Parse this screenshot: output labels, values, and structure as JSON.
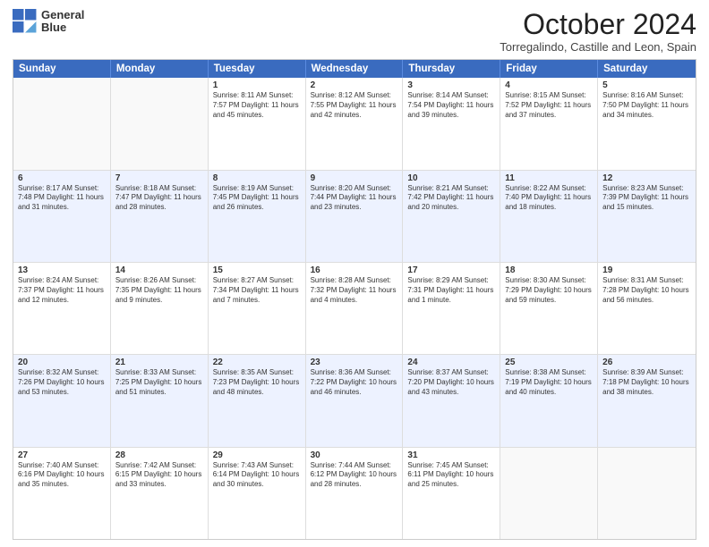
{
  "logo": {
    "line1": "General",
    "line2": "Blue"
  },
  "title": "October 2024",
  "subtitle": "Torregalindo, Castille and Leon, Spain",
  "days": [
    "Sunday",
    "Monday",
    "Tuesday",
    "Wednesday",
    "Thursday",
    "Friday",
    "Saturday"
  ],
  "weeks": [
    [
      {
        "day": "",
        "info": ""
      },
      {
        "day": "",
        "info": ""
      },
      {
        "day": "1",
        "info": "Sunrise: 8:11 AM\nSunset: 7:57 PM\nDaylight: 11 hours and 45 minutes."
      },
      {
        "day": "2",
        "info": "Sunrise: 8:12 AM\nSunset: 7:55 PM\nDaylight: 11 hours and 42 minutes."
      },
      {
        "day": "3",
        "info": "Sunrise: 8:14 AM\nSunset: 7:54 PM\nDaylight: 11 hours and 39 minutes."
      },
      {
        "day": "4",
        "info": "Sunrise: 8:15 AM\nSunset: 7:52 PM\nDaylight: 11 hours and 37 minutes."
      },
      {
        "day": "5",
        "info": "Sunrise: 8:16 AM\nSunset: 7:50 PM\nDaylight: 11 hours and 34 minutes."
      }
    ],
    [
      {
        "day": "6",
        "info": "Sunrise: 8:17 AM\nSunset: 7:48 PM\nDaylight: 11 hours and 31 minutes."
      },
      {
        "day": "7",
        "info": "Sunrise: 8:18 AM\nSunset: 7:47 PM\nDaylight: 11 hours and 28 minutes."
      },
      {
        "day": "8",
        "info": "Sunrise: 8:19 AM\nSunset: 7:45 PM\nDaylight: 11 hours and 26 minutes."
      },
      {
        "day": "9",
        "info": "Sunrise: 8:20 AM\nSunset: 7:44 PM\nDaylight: 11 hours and 23 minutes."
      },
      {
        "day": "10",
        "info": "Sunrise: 8:21 AM\nSunset: 7:42 PM\nDaylight: 11 hours and 20 minutes."
      },
      {
        "day": "11",
        "info": "Sunrise: 8:22 AM\nSunset: 7:40 PM\nDaylight: 11 hours and 18 minutes."
      },
      {
        "day": "12",
        "info": "Sunrise: 8:23 AM\nSunset: 7:39 PM\nDaylight: 11 hours and 15 minutes."
      }
    ],
    [
      {
        "day": "13",
        "info": "Sunrise: 8:24 AM\nSunset: 7:37 PM\nDaylight: 11 hours and 12 minutes."
      },
      {
        "day": "14",
        "info": "Sunrise: 8:26 AM\nSunset: 7:35 PM\nDaylight: 11 hours and 9 minutes."
      },
      {
        "day": "15",
        "info": "Sunrise: 8:27 AM\nSunset: 7:34 PM\nDaylight: 11 hours and 7 minutes."
      },
      {
        "day": "16",
        "info": "Sunrise: 8:28 AM\nSunset: 7:32 PM\nDaylight: 11 hours and 4 minutes."
      },
      {
        "day": "17",
        "info": "Sunrise: 8:29 AM\nSunset: 7:31 PM\nDaylight: 11 hours and 1 minute."
      },
      {
        "day": "18",
        "info": "Sunrise: 8:30 AM\nSunset: 7:29 PM\nDaylight: 10 hours and 59 minutes."
      },
      {
        "day": "19",
        "info": "Sunrise: 8:31 AM\nSunset: 7:28 PM\nDaylight: 10 hours and 56 minutes."
      }
    ],
    [
      {
        "day": "20",
        "info": "Sunrise: 8:32 AM\nSunset: 7:26 PM\nDaylight: 10 hours and 53 minutes."
      },
      {
        "day": "21",
        "info": "Sunrise: 8:33 AM\nSunset: 7:25 PM\nDaylight: 10 hours and 51 minutes."
      },
      {
        "day": "22",
        "info": "Sunrise: 8:35 AM\nSunset: 7:23 PM\nDaylight: 10 hours and 48 minutes."
      },
      {
        "day": "23",
        "info": "Sunrise: 8:36 AM\nSunset: 7:22 PM\nDaylight: 10 hours and 46 minutes."
      },
      {
        "day": "24",
        "info": "Sunrise: 8:37 AM\nSunset: 7:20 PM\nDaylight: 10 hours and 43 minutes."
      },
      {
        "day": "25",
        "info": "Sunrise: 8:38 AM\nSunset: 7:19 PM\nDaylight: 10 hours and 40 minutes."
      },
      {
        "day": "26",
        "info": "Sunrise: 8:39 AM\nSunset: 7:18 PM\nDaylight: 10 hours and 38 minutes."
      }
    ],
    [
      {
        "day": "27",
        "info": "Sunrise: 7:40 AM\nSunset: 6:16 PM\nDaylight: 10 hours and 35 minutes."
      },
      {
        "day": "28",
        "info": "Sunrise: 7:42 AM\nSunset: 6:15 PM\nDaylight: 10 hours and 33 minutes."
      },
      {
        "day": "29",
        "info": "Sunrise: 7:43 AM\nSunset: 6:14 PM\nDaylight: 10 hours and 30 minutes."
      },
      {
        "day": "30",
        "info": "Sunrise: 7:44 AM\nSunset: 6:12 PM\nDaylight: 10 hours and 28 minutes."
      },
      {
        "day": "31",
        "info": "Sunrise: 7:45 AM\nSunset: 6:11 PM\nDaylight: 10 hours and 25 minutes."
      },
      {
        "day": "",
        "info": ""
      },
      {
        "day": "",
        "info": ""
      }
    ]
  ],
  "alt_rows": [
    1,
    3
  ]
}
